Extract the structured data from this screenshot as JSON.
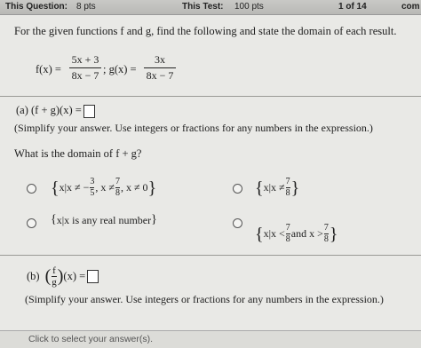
{
  "header": {
    "question_label": "This Question:",
    "question_pts": "8 pts",
    "test_label": "This Test:",
    "test_pts": "100 pts",
    "progress": "1 of 14",
    "status": "com"
  },
  "problem": {
    "prompt": "For the given functions f and g, find the following and state the domain of each result.",
    "f_lhs": "f(x) =",
    "f_num": "5x + 3",
    "f_den": "8x − 7",
    "sep": "; g(x) =",
    "g_num": "3x",
    "g_den": "8x − 7"
  },
  "part_a": {
    "label": "(a)  (f + g)(x) =",
    "instruction": "(Simplify your answer. Use integers or fractions for any numbers in the expression.)",
    "domain_question": "What is the domain of f + g?",
    "options": [
      {
        "text_pre": "x|x ≠ −",
        "n1": "3",
        "d1": "5",
        "mid": ", x ≠",
        "n2": "7",
        "d2": "8",
        "post": ", x ≠ 0"
      },
      {
        "text_pre": "x|x ≠",
        "n1": "7",
        "d1": "8"
      },
      {
        "text": "x|x is any real number"
      },
      {
        "text_pre": "x|x <",
        "n1": "7",
        "d1": "8",
        "mid": " and x >",
        "n2": "7",
        "d2": "8"
      }
    ]
  },
  "part_b": {
    "label": "(b)",
    "f": "f",
    "g": "g",
    "after": "(x) =",
    "instruction": "(Simplify your answer. Use integers or fractions for any numbers in the expression.)"
  },
  "footer": {
    "hint": "Click to select your answer(s)."
  }
}
